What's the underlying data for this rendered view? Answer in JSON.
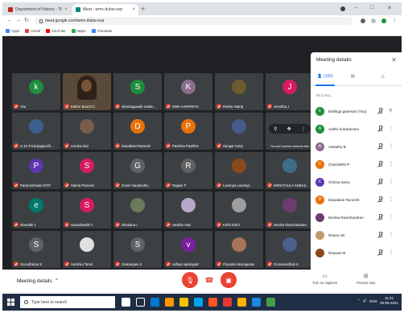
{
  "browser": {
    "tabs": [
      {
        "title": "Department of History - Thiruv...",
        "favicon_color": "#c5221f",
        "active": false
      },
      {
        "title": "Meet - wmv-dubw-ovp",
        "favicon_color": "#00897b",
        "active": true
      }
    ],
    "url": "meet.google.com/wmv-dubw-ovp",
    "bookmarks": [
      {
        "label": "Apps",
        "color": "#4285f4"
      },
      {
        "label": "Gmail",
        "color": "#ea4335"
      },
      {
        "label": "YouTube",
        "color": "#ff0000"
      },
      {
        "label": "Maps",
        "color": "#34a853"
      },
      {
        "label": "Translate",
        "color": "#4285f4"
      }
    ]
  },
  "grid": {
    "tiles": [
      {
        "name": "You",
        "initial": "k",
        "color": "#1e8e3e",
        "kind": "initial"
      },
      {
        "name": "Esther Boomi C",
        "kind": "camera"
      },
      {
        "name": "shenbagavalli sivalin...",
        "initial": "S",
        "color": "#1e8e3e",
        "kind": "initial"
      },
      {
        "name": "KNR HARIPRIYA",
        "initial": "K",
        "color": "#8c6d8d",
        "kind": "initial"
      },
      {
        "name": "Rekha Natraj",
        "kind": "photo",
        "color": "#6d5a2e"
      },
      {
        "name": "Jeevitha J",
        "initial": "J",
        "color": "#d81b60",
        "kind": "initial"
      },
      {
        "name": "Lt.Dr P.Karpagavalli ...",
        "kind": "photo",
        "color": "#3b5f8a"
      },
      {
        "name": "renuka devi",
        "kind": "photo",
        "color": "#7a5c4a"
      },
      {
        "name": "Daivakani Ramesh",
        "initial": "D",
        "color": "#e8710a",
        "kind": "initial"
      },
      {
        "name": "Pavithra Pavithra",
        "initial": "P",
        "color": "#e8710a",
        "kind": "initial"
      },
      {
        "name": "Sangar Kutty",
        "kind": "photo",
        "color": "#455a8a"
      },
      {
        "name": "You can't unmute someone else",
        "kind": "hover"
      },
      {
        "name": "Parameshwari 9787",
        "initial": "P",
        "color": "#5e35b1",
        "kind": "initial"
      },
      {
        "name": "Salma Parveen",
        "initial": "S",
        "color": "#d81b60",
        "kind": "initial"
      },
      {
        "name": "Gowri Vanjimuthu",
        "initial": "G",
        "color": "#5f6368",
        "kind": "initial"
      },
      {
        "name": "Ragavi P",
        "initial": "R",
        "color": "#616161",
        "kind": "initial"
      },
      {
        "name": "Lavanya Lavanya",
        "kind": "photo",
        "color": "#8a4a1c"
      },
      {
        "name": "MIRUTHULA ANBAZ...",
        "kind": "photo",
        "color": "#3c6e8a"
      },
      {
        "name": "elamathi s",
        "initial": "e",
        "color": "#00796b",
        "kind": "initial"
      },
      {
        "name": "sarasthwathi s",
        "initial": "S",
        "color": "#d81b60",
        "kind": "initial"
      },
      {
        "name": "Shobana I",
        "kind": "photo",
        "color": "#6b7a5a"
      },
      {
        "name": "vanitha Vani",
        "kind": "photo",
        "color": "#b7a7c9"
      },
      {
        "name": "Kirthi Kirthi",
        "kind": "photo",
        "color": "#9e9e9e"
      },
      {
        "name": "Devika Ravichandran",
        "kind": "photo",
        "color": "#6d3b6e"
      },
      {
        "name": "Soundharya S",
        "initial": "S",
        "color": "#5f6368",
        "kind": "initial"
      },
      {
        "name": "Harshini Tamil",
        "kind": "photo",
        "color": "#e0e0e0"
      },
      {
        "name": "Sivaranjani K",
        "initial": "S",
        "color": "#5f6368",
        "kind": "initial"
      },
      {
        "name": "vidhya rajalingam",
        "initial": "v",
        "color": "#7b1fa2",
        "kind": "initial"
      },
      {
        "name": "Priyanka Murugesan",
        "kind": "photo",
        "color": "#a8755a"
      },
      {
        "name": "Gunasundhari K",
        "kind": "photo",
        "color": "#4a5f8a"
      }
    ],
    "hover_icons": [
      "⚲",
      "✥",
      "⋮"
    ]
  },
  "panel": {
    "title": "Meeting details",
    "people_count": "(100)",
    "in_call_label": "IN CALL",
    "participants": [
      {
        "name": "karthiga ganesan (You)",
        "initial": "k",
        "color": "#1e8e3e"
      },
      {
        "name": "Aarthi Subaramani",
        "initial": "A",
        "color": "#1e8e3e"
      },
      {
        "name": "Aswathy B",
        "initial": "A",
        "color": "#8c6d8d"
      },
      {
        "name": "Charulekhi P",
        "initial": "C",
        "color": "#e8710a"
      },
      {
        "name": "Chinna samy",
        "initial": "C",
        "color": "#5e35b1"
      },
      {
        "name": "Daivakani Ramesh",
        "initial": "D",
        "color": "#e8710a"
      },
      {
        "name": "Devika Ravichandran",
        "initial": "",
        "color": "#6d3b6e"
      },
      {
        "name": "Dhana Sri",
        "initial": "",
        "color": "#c49a6c"
      },
      {
        "name": "Dharani M",
        "initial": "",
        "color": "#8a4a1c"
      }
    ]
  },
  "controls": {
    "details_label": "Meeting details",
    "captions_label": "Turn on captions",
    "present_label": "Present now"
  },
  "taskbar": {
    "search_placeholder": "Type here to search",
    "time": "11:31",
    "date": "28-05-2021",
    "lang": "ENG",
    "apps": [
      "#ffffff",
      "#1f2e44",
      "#0078d4",
      "#ff9800",
      "#f8c400",
      "#00a4ef",
      "#ff5722",
      "#e53935",
      "#ffb300",
      "#1e88e5",
      "#43a047"
    ]
  }
}
